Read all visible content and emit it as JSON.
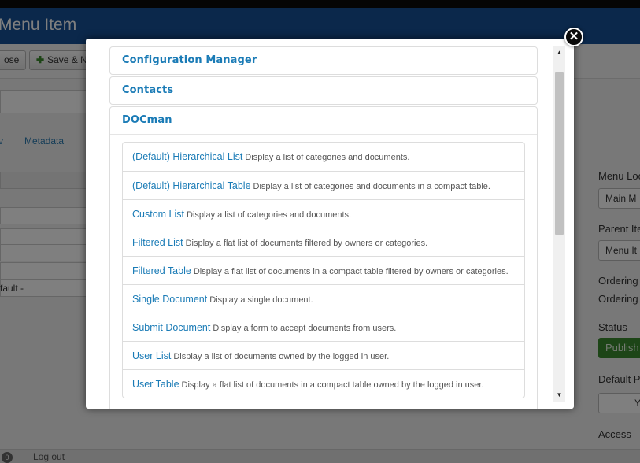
{
  "page": {
    "header_title": "Menu Item",
    "toolbar": {
      "close_label": "ose",
      "save_new_label": "Save & N"
    },
    "tabs": [
      "v",
      "Metadata"
    ],
    "default_value": "fault -",
    "right_panel": {
      "menu_location_label": "Menu Loc",
      "menu_location_value": "Main M",
      "parent_item_label": "Parent Ite",
      "parent_item_value": "Menu It",
      "ordering_label_1": "Ordering",
      "ordering_label_2": "Ordering",
      "status_label": "Status",
      "status_value": "Publish",
      "default_page_label": "Default P",
      "default_page_value": "Y",
      "access_label": "Access"
    },
    "footer": {
      "count": "0",
      "logout_label": "Log out"
    }
  },
  "modal": {
    "close_glyph": "✕",
    "groups": [
      {
        "label": "Configuration Manager"
      },
      {
        "label": "Contacts"
      },
      {
        "label": "DOCman",
        "items": [
          {
            "title": "(Default) Hierarchical List",
            "desc": "Display a list of categories and documents."
          },
          {
            "title": "(Default) Hierarchical Table",
            "desc": "Display a list of categories and documents in a compact table."
          },
          {
            "title": "Custom List",
            "desc": "Display a list of categories and documents."
          },
          {
            "title": "Filtered List",
            "desc": "Display a flat list of documents filtered by owners or categories."
          },
          {
            "title": "Filtered Table",
            "desc": "Display a flat list of documents in a compact table filtered by owners or categories."
          },
          {
            "title": "Single Document",
            "desc": "Display a single document."
          },
          {
            "title": "Submit Document",
            "desc": "Display a form to accept documents from users."
          },
          {
            "title": "User List",
            "desc": "Display a list of documents owned by the logged in user."
          },
          {
            "title": "User Table",
            "desc": "Display a flat list of documents in a compact table owned by the logged in user."
          }
        ]
      }
    ],
    "scrollbar": {
      "up_glyph": "▲",
      "down_glyph": "▼"
    }
  },
  "colors": {
    "header_blue": "#175196",
    "link_blue": "#1a7bb6",
    "publish_green": "#3a8a2e"
  }
}
